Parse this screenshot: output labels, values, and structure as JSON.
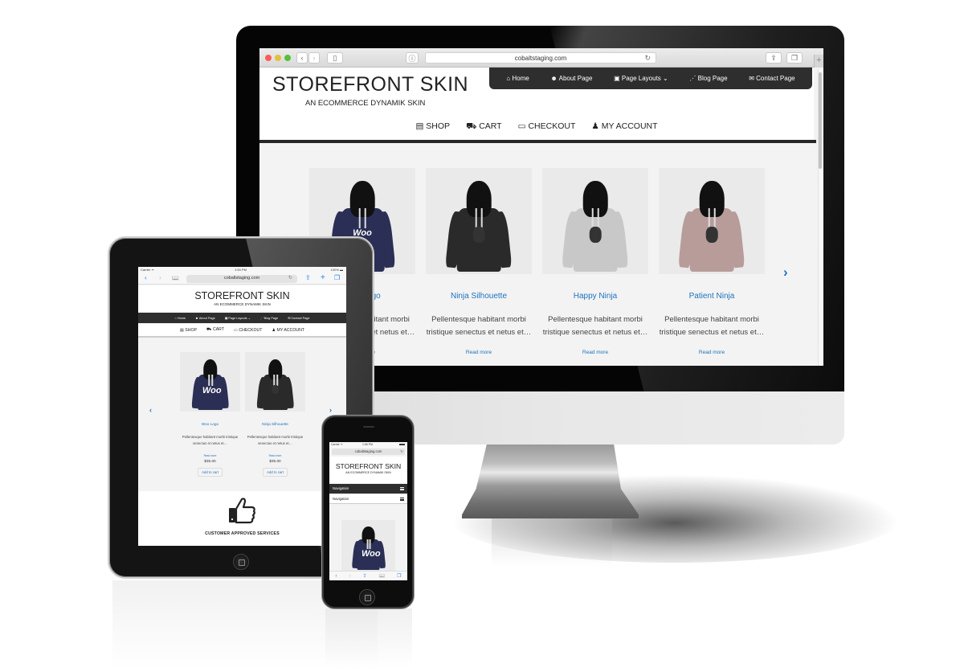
{
  "desktop": {
    "browser": {
      "url": "cobaltstaging.com",
      "buttons": {
        "back": "‹",
        "forward": "›",
        "sidebar": "▯",
        "info": "ⓘ",
        "reload": "↻",
        "share": "⇪",
        "tabs": "❐",
        "new_tab": "+"
      }
    },
    "site": {
      "title": "STOREFRONT SKIN",
      "tagline": "AN ECOMMERCE DYNAMIK SKIN",
      "top_nav": [
        {
          "icon": "home-icon",
          "glyph": "⌂",
          "label": "Home"
        },
        {
          "icon": "users-icon",
          "glyph": "☻",
          "label": "About Page"
        },
        {
          "icon": "image-icon",
          "glyph": "▣",
          "label": "Page Layouts ⌄"
        },
        {
          "icon": "rss-icon",
          "glyph": "⋰",
          "label": "Blog Page"
        },
        {
          "icon": "envelope-icon",
          "glyph": "✉",
          "label": "Contact Page"
        }
      ],
      "main_nav": [
        {
          "icon": "building-icon",
          "glyph": "▤",
          "label": "SHOP"
        },
        {
          "icon": "cart-icon",
          "glyph": "⛟",
          "label": "CART"
        },
        {
          "icon": "money-icon",
          "glyph": "▭",
          "label": "CHECKOUT"
        },
        {
          "icon": "user-icon",
          "glyph": "♟",
          "label": "MY ACCOUNT"
        }
      ],
      "products": [
        {
          "name": "Woo Logo",
          "description": "Pellentesque habitant morbi tristique senectus et netus et…",
          "link": "Read more",
          "color": "#2b2f55",
          "print": "Woo"
        },
        {
          "name": "Ninja Silhouette",
          "description": "Pellentesque habitant morbi tristique senectus et netus et…",
          "link": "Read more",
          "color": "#2a2a2a",
          "print": ""
        },
        {
          "name": "Happy Ninja",
          "description": "Pellentesque habitant morbi tristique senectus et netus et…",
          "link": "Read more",
          "color": "#c8c8c8",
          "print": ""
        },
        {
          "name": "Patient Ninja",
          "description": "Pellentesque habitant morbi tristique senectus et netus et…",
          "link": "Read more",
          "color": "#b79c9a",
          "print": ""
        }
      ],
      "next_arrow": "›"
    }
  },
  "tablet": {
    "status": {
      "carrier": "Carrier ᯤ",
      "time": "1:53 PM",
      "battery": "100% ▬"
    },
    "browser": {
      "url": "cobaltstaging.com",
      "back": "‹",
      "forward": "›",
      "bookmarks": "📖",
      "reload": "↻",
      "share": "⇪",
      "add": "+",
      "tabs": "❐"
    },
    "site": {
      "title": "STOREFRONT SKIN",
      "tagline": "AN ECOMMERCE DYNAMIK SKIN",
      "top_nav": [
        "⌂ Home",
        "☻ About Page",
        "▣ Page Layouts ⌄",
        "⋰ Blog Page",
        "✉ Contact Page"
      ],
      "main_nav": [
        "▤ SHOP",
        "⛟ CART",
        "▭ CHECKOUT",
        "♟ MY ACCOUNT"
      ],
      "products": [
        {
          "name": "Woo Logo",
          "description": "Pellentesque habitant morbi tristique senectus et netus et…",
          "link": "Read more",
          "price": "$35.00",
          "button": "Add to cart",
          "color": "#2b2f55",
          "print": "Woo"
        },
        {
          "name": "Ninja Silhouette",
          "description": "Pellentesque habitant morbi tristique senectus et netus et…",
          "link": "Read more",
          "price": "$35.00",
          "button": "Add to cart",
          "color": "#2a2a2a",
          "print": ""
        }
      ],
      "prev_arrow": "‹",
      "next_arrow": "›",
      "feature_label": "CUSTOMER APPROVED SERVICES"
    }
  },
  "phone": {
    "status": {
      "carrier": "Carrier ᯤ",
      "time": "1:56 PM"
    },
    "browser": {
      "url": "cobaltstaging.com",
      "reload": "↻",
      "back": "‹",
      "forward": "›",
      "share": "⇪",
      "bookmarks": "📖",
      "tabs": "❐"
    },
    "site": {
      "title": "STOREFRONT SKIN",
      "tagline": "AN ECOMMERCE DYNAMIK SKIN",
      "nav_primary": "Navigation",
      "nav_secondary": "Navigation",
      "product": {
        "color": "#2b2f55",
        "print": "Woo"
      }
    }
  },
  "colors": {
    "accent": "#1e73be",
    "nav_dark": "#2e2e2e",
    "ios_blue": "#1e7ef3"
  }
}
